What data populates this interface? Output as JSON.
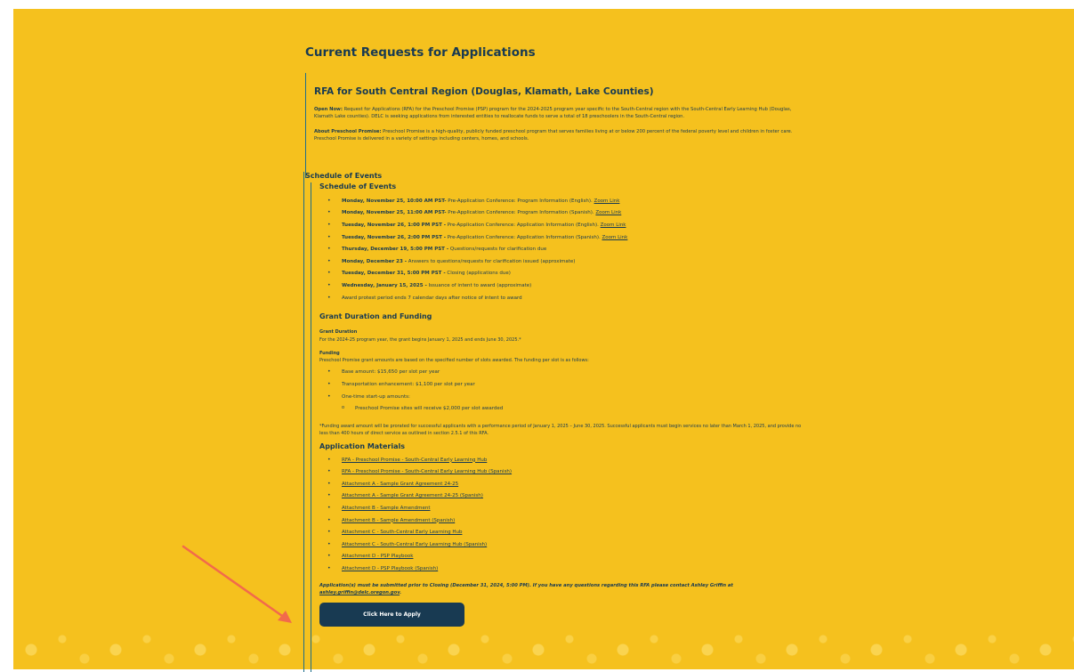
{
  "page": {
    "title": "Current Requests for Applications"
  },
  "rfa": {
    "title": "RFA for South Central Region (Douglas, Klamath, Lake Counties)",
    "open_now_label": "Open Now:",
    "open_now_text": " Request for Applications (RFA) for the Preschool Promise (PSP) program for the 2024-2025 program year specific to the South-Central region with the South-Central Early Learning Hub (Douglas, Klamath Lake counties). DELC is seeking applications from interested entities to reallocate funds to serve a total of 18 preschoolers in the South-Central region.",
    "about_label": "About Preschool Promise:",
    "about_text": " Preschool Promise is a high-quality, publicly funded preschool program that serves families living at or below 200 percent of the federal poverty level and children in foster care. Preschool Promise is delivered in a variety of settings including centers, homes, and schools."
  },
  "schedule": {
    "outer_title": "Schedule of Events",
    "title": "Schedule of Events",
    "events": [
      {
        "date": "Monday, November 25, 10:00 AM PST-",
        "text": " Pre-Application Conference: Program Information (English). ",
        "link": "Zoom Link"
      },
      {
        "date": "Monday, November 25, 11:00 AM PST-",
        "text": " Pre-Application Conference: Program Information (Spanish). ",
        "link": "Zoom Link"
      },
      {
        "date": "Tuesday, November 26, 1:00 PM PST -",
        "text": " Pre-Application Conference: Application Information (English). ",
        "link": "Zoom Link"
      },
      {
        "date": "Tuesday, November 26, 2:00 PM PST -",
        "text": " Pre-Application Conference: Application Information (Spanish). ",
        "link": "Zoom Link"
      },
      {
        "date": "Thursday, December 19, 5:00 PM PST -",
        "text": " Questions/requests for clarification due",
        "link": ""
      },
      {
        "date": "Monday, December 23 -",
        "text": " Answers to questions/requests for clarification issued (approximate)",
        "link": ""
      },
      {
        "date": "Tuesday, December 31, 5:00 PM PST -",
        "text": " Closing (applications due)",
        "link": ""
      },
      {
        "date": "Wednesday, January 15, 2025 -",
        "text": " Issuance of intent to award (approximate)",
        "link": ""
      },
      {
        "date": "",
        "text": "Award protest period ends 7 calendar days after notice of intent to award",
        "link": ""
      }
    ]
  },
  "grant": {
    "title": "Grant Duration and Funding",
    "duration_label": "Grant Duration",
    "duration_text": "For the 2024-25 program year, the grant begins January 1, 2025 and ends June 30, 2025.*",
    "funding_label": "Funding",
    "funding_text": "Preschool Promise grant amounts are based on the specified number of slots awarded.  The funding per slot is as follows:",
    "items": [
      "Base amount: $15,650 per slot per year",
      "Transportation enhancement: $1,100 per slot per year",
      "One-time start-up amounts:"
    ],
    "sub_item": "Preschool Promise sites will receive $2,000 per slot awarded",
    "note": "*Funding award amount will be prorated for successful applicants with a performance period of January 1, 2025 – June 30, 2025. Successful applicants must begin services no later than March 1, 2025, and provide no less than 400 hours of direct service as outlined in section 2.5.1 of this RFA."
  },
  "materials": {
    "title": "Application Materials",
    "links": [
      "RFA - Preschool Promise - South-Central Early Learning Hub",
      "RFA - Preschool Promise - South-Central Early Learning Hub (Spanish)",
      "Attachment A - Sample Grant Agreement 24-25",
      "Attachment A - Sample Grant Agreement 24-25 (Spanish)",
      "Attachment B - Sample Amendment",
      "Attachment B - Sample Amendment (Spanish)",
      "Attachment C - South-Central Early Learning Hub",
      "Attachment C - South-Central Early Learning Hub (Spanish)",
      "Attachment D - PSP Playbook",
      "Attachment D - PSP Playbook (Spanish)"
    ],
    "closing_text": "Application(s) must be submitted prior to Closing (December 31, 2024, 5:00 PM). If you have any questions regarding this RFA please contact Ashley Griffin at ",
    "email": "ashley.griffin@delc.oregon.gov",
    "closing_end": ".",
    "apply_label": "Click Here to Apply"
  },
  "colors": {
    "background": "#f5c11e",
    "text": "#183a52",
    "button": "#183a52",
    "arrow": "#f26a4b"
  }
}
